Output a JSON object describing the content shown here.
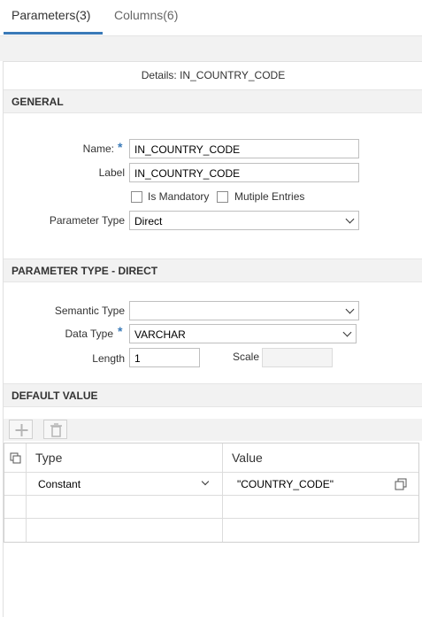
{
  "tabs": [
    {
      "label": "Parameters(3)",
      "active": true
    },
    {
      "label": "Columns(6)",
      "active": false
    }
  ],
  "details": {
    "title": "Details: IN_COUNTRY_CODE"
  },
  "general": {
    "heading": "GENERAL",
    "name_label": "Name:",
    "name_value": "IN_COUNTRY_CODE",
    "label_label": "Label",
    "label_value": "IN_COUNTRY_CODE",
    "is_mandatory_label": "Is Mandatory",
    "multiple_entries_label": "Mutiple Entries",
    "param_type_label": "Parameter Type",
    "param_type_value": "Direct"
  },
  "direct": {
    "heading": "PARAMETER TYPE - DIRECT",
    "semantic_type_label": "Semantic Type",
    "semantic_type_value": "",
    "data_type_label": "Data Type",
    "data_type_value": "VARCHAR",
    "length_label": "Length",
    "length_value": "1",
    "scale_label": "Scale",
    "scale_value": ""
  },
  "default_value": {
    "heading": "DEFAULT VALUE",
    "columns": [
      "Type",
      "Value"
    ],
    "rows": [
      {
        "type": "Constant",
        "value": "\"COUNTRY_CODE\""
      }
    ]
  },
  "colors": {
    "accent": "#3a7ab8",
    "section_bg": "#f2f2f2"
  }
}
